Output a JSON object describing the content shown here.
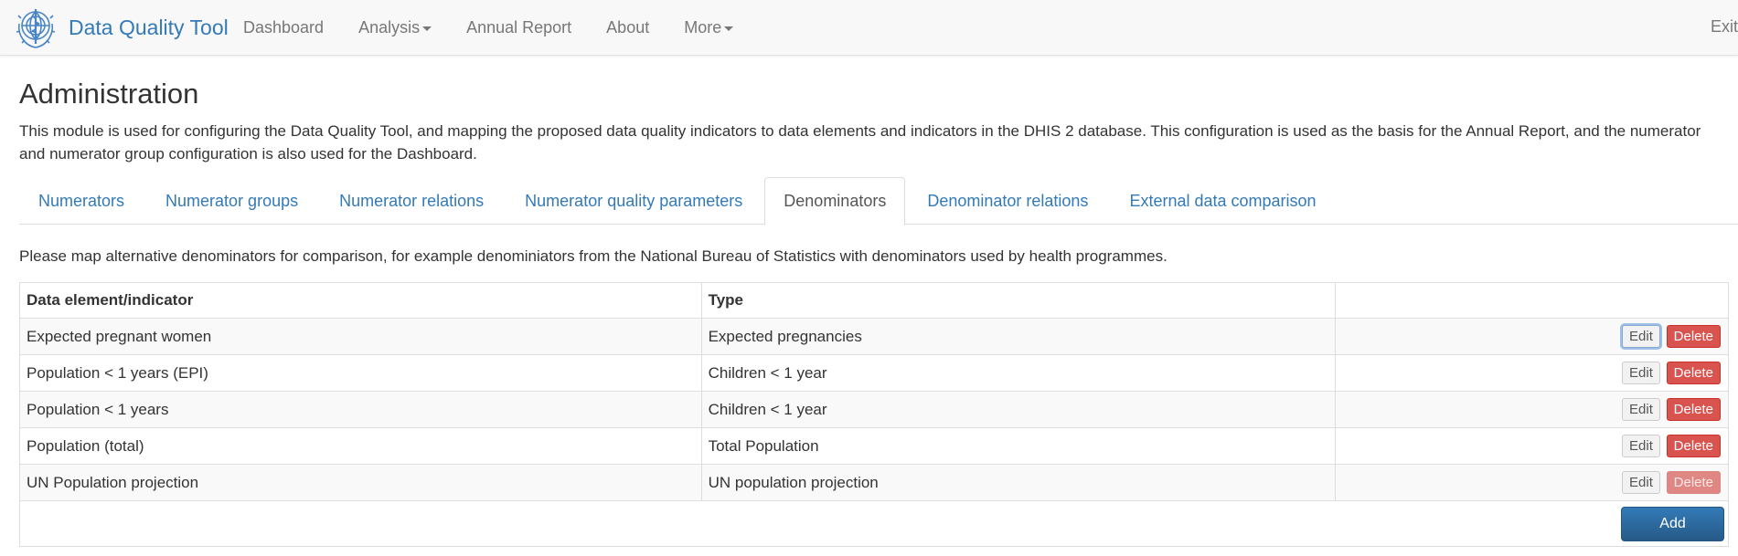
{
  "navbar": {
    "brand": "Data Quality Tool",
    "items": [
      {
        "label": "Dashboard",
        "dropdown": false
      },
      {
        "label": "Analysis",
        "dropdown": true
      },
      {
        "label": "Annual Report",
        "dropdown": false
      },
      {
        "label": "About",
        "dropdown": false
      },
      {
        "label": "More",
        "dropdown": true
      }
    ],
    "exit": "Exit"
  },
  "page": {
    "title": "Administration",
    "description": "This module is used for configuring the Data Quality Tool, and mapping the proposed data quality indicators to data elements and indicators in the DHIS 2 database. This configuration is used as the basis for the Annual Report, and the numerator and numerator group configuration is also used for the Dashboard."
  },
  "tabs": [
    {
      "label": "Numerators",
      "active": false
    },
    {
      "label": "Numerator groups",
      "active": false
    },
    {
      "label": "Numerator relations",
      "active": false
    },
    {
      "label": "Numerator quality parameters",
      "active": false
    },
    {
      "label": "Denominators",
      "active": true
    },
    {
      "label": "Denominator relations",
      "active": false
    },
    {
      "label": "External data comparison",
      "active": false
    }
  ],
  "denominators": {
    "intro": "Please map alternative denominators for comparison, for example denominiators from the National Bureau of Statistics with denominators used by health programmes.",
    "columns": [
      "Data element/indicator",
      "Type",
      ""
    ],
    "rows": [
      {
        "name": "Expected pregnant women",
        "type": "Expected pregnancies"
      },
      {
        "name": "Population < 1 years (EPI)",
        "type": "Children < 1 year"
      },
      {
        "name": "Population < 1 years",
        "type": "Children < 1 year"
      },
      {
        "name": "Population (total)",
        "type": "Total Population"
      },
      {
        "name": "UN Population projection",
        "type": "UN population projection"
      }
    ],
    "edit_label": "Edit",
    "delete_label": "Delete",
    "add_label": "Add"
  },
  "colors": {
    "link": "#337ab7",
    "delete": "#d9534f",
    "add": "#2e6da4"
  }
}
